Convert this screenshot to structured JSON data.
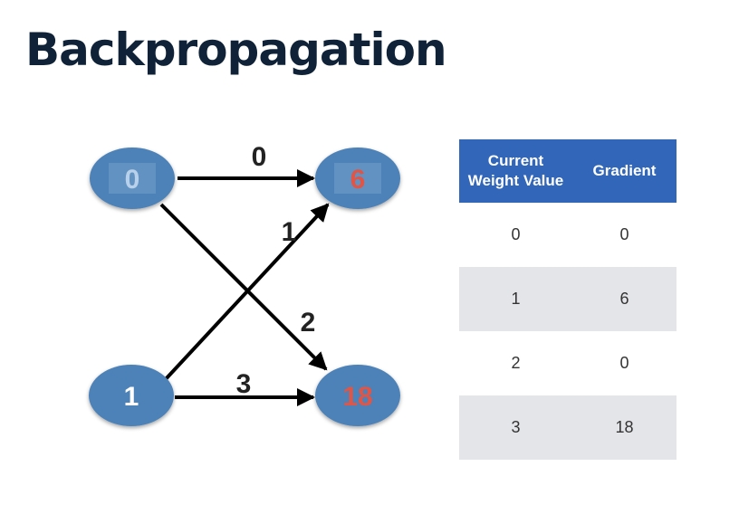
{
  "title": "Backpropagation",
  "diagram": {
    "input_nodes": [
      {
        "label": "0",
        "label_color": "#b8d0ea"
      },
      {
        "label": "1",
        "label_color": "#ffffff"
      }
    ],
    "output_nodes": [
      {
        "label": "6",
        "label_color": "#e05545"
      },
      {
        "label": "18",
        "label_color": "#e05545"
      }
    ],
    "edge_labels": [
      "0",
      "1",
      "2",
      "3"
    ],
    "node_color": "#4d82b8"
  },
  "table": {
    "headers": [
      "Current Weight Value",
      "Gradient"
    ],
    "rows": [
      [
        "0",
        "0"
      ],
      [
        "1",
        "6"
      ],
      [
        "2",
        "0"
      ],
      [
        "3",
        "18"
      ]
    ],
    "header_color": "#3166b9",
    "stripe_color": "#e4e5e8"
  }
}
